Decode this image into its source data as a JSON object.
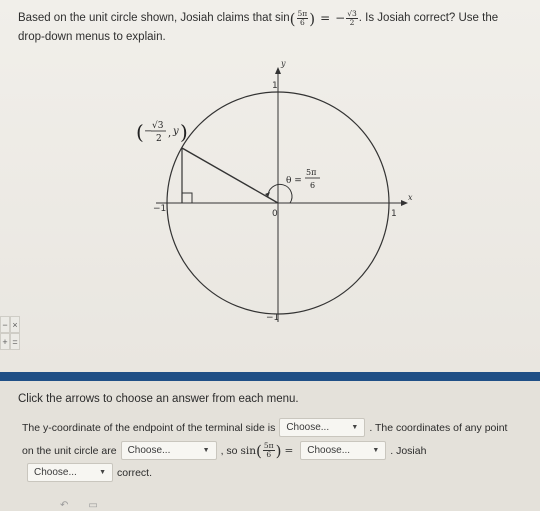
{
  "question": {
    "line1_prefix": "Based on the unit circle shown, Josiah claims that sin",
    "angle_num": "5π",
    "angle_den": "6",
    "equals": "=",
    "minus": "−",
    "value_num": "√3",
    "value_den": "2",
    "line1_suffix": ". Is Josiah correct? Use the",
    "line2": "drop-down menus to explain."
  },
  "diagram": {
    "y_axis_label": "y",
    "x_axis_label": "x",
    "tick_top": "1",
    "tick_bottom": "−1",
    "tick_left": "−1",
    "tick_right": "1",
    "origin": "0",
    "point_label_minus": "−",
    "point_label_num": "√3",
    "point_label_den": "2",
    "point_label_y": "y",
    "theta_label": "θ =",
    "theta_num": "5π",
    "theta_den": "6"
  },
  "keypad": {
    "minus": "−",
    "times": "×",
    "plus": "+",
    "equals": "="
  },
  "instruction": "Click the arrows to choose an answer from each menu.",
  "answer": {
    "text1": "The y-coordinate of the endpoint of the terminal side is",
    "text2": ". The coordinates of any point",
    "text3": "on the unit circle are",
    "text4": ", so",
    "sin": "sin",
    "frac_num": "5π",
    "frac_den": "6",
    "eq": "=",
    "text5": ". Josiah",
    "text6": "correct.",
    "dropdown1": "Choose...",
    "dropdown2": "Choose...",
    "dropdown3": "Choose...",
    "dropdown4": "Choose..."
  }
}
